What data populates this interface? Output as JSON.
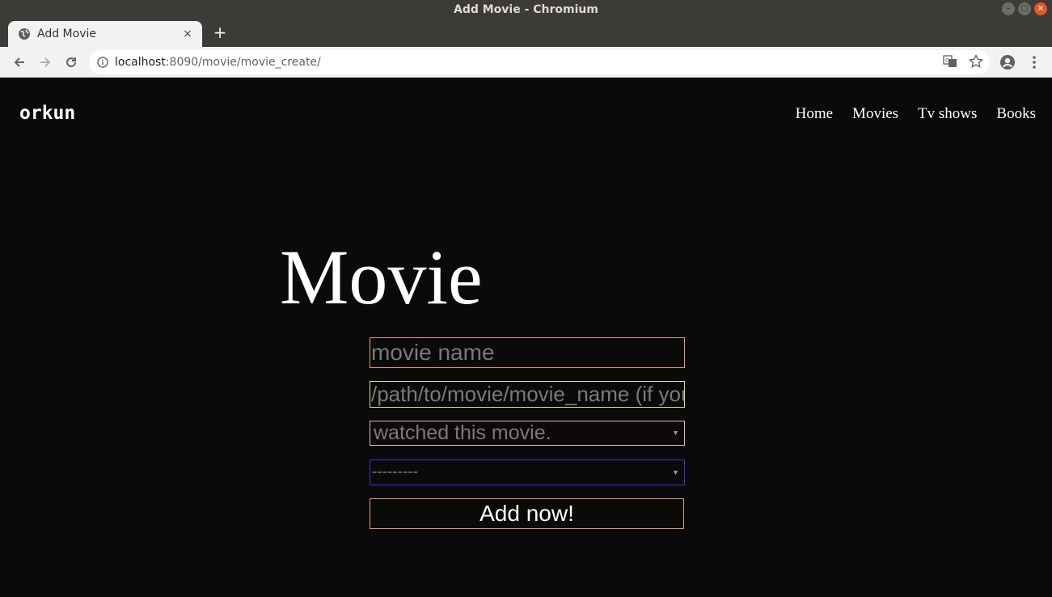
{
  "window": {
    "title": "Add Movie - Chromium",
    "controls": [
      "minimize-icon",
      "maximize-icon",
      "close-icon"
    ]
  },
  "browser": {
    "tab_title": "Add Movie",
    "tab_close": "×",
    "new_tab": "+",
    "url_host": "localhost",
    "url_path": ":8090/movie/movie_create/"
  },
  "site": {
    "brand": "orkun",
    "nav": [
      "Home",
      "Movies",
      "Tv shows",
      "Books"
    ]
  },
  "form": {
    "heading": "Movie",
    "movie_name_placeholder": "movie name",
    "path_placeholder": "/path/to/movie/movie_name (if you",
    "watched_selected": "watched this movie.",
    "category_selected": "---------",
    "submit_label": "Add now!"
  },
  "colors": {
    "page_background": "#0a0a0a",
    "name_border": "#e0a070",
    "path_border": "#d7e08a",
    "watched_border": "#e0b4d8",
    "category_border": "#4a2bd8"
  }
}
